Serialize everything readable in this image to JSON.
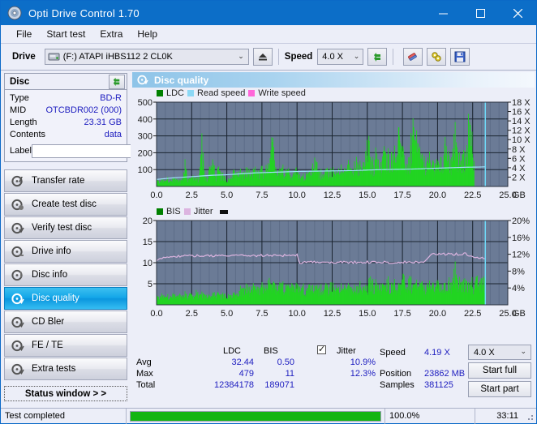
{
  "window": {
    "title": "Opti Drive Control 1.70",
    "title_icon": "disc-icon",
    "minimize": "—",
    "maximize": "□",
    "close": "✕",
    "accent": "#0c6ec8"
  },
  "menu": [
    {
      "label": "File"
    },
    {
      "label": "Start test"
    },
    {
      "label": "Extra"
    },
    {
      "label": "Help"
    }
  ],
  "toolbar": {
    "drive_label": "Drive",
    "drive_value": "(F:)  ATAPI iHBS112  2 CL0K",
    "eject_icon": "eject-icon",
    "speed_label": "Speed",
    "speed_value": "4.0 X",
    "refresh_icon": "refresh-icon",
    "erase_icon": "eraser-icon",
    "tools_icon": "tools-icon",
    "save_icon": "save-icon"
  },
  "disc": {
    "header": "Disc",
    "refresh_icon": "refresh-icon",
    "rows": [
      {
        "key": "Type",
        "value": "BD-R"
      },
      {
        "key": "MID",
        "value": "OTCBDR002 (000)"
      },
      {
        "key": "Length",
        "value": "23.31 GB"
      },
      {
        "key": "Contents",
        "value": "data"
      }
    ],
    "label_key": "Label",
    "label_value": "",
    "label_placeholder": "",
    "label_icon": "cd-icon"
  },
  "tests": [
    {
      "label": "Transfer rate",
      "icon": "disc-speed-icon",
      "active": false
    },
    {
      "label": "Create test disc",
      "icon": "disc-write-icon",
      "active": false
    },
    {
      "label": "Verify test disc",
      "icon": "disc-verify-icon",
      "active": false
    },
    {
      "label": "Drive info",
      "icon": "drive-info-icon",
      "active": false
    },
    {
      "label": "Disc info",
      "icon": "disc-info-icon",
      "active": false
    },
    {
      "label": "Disc quality",
      "icon": "disc-quality-icon",
      "active": true
    },
    {
      "label": "CD Bler",
      "icon": "disc-bler-icon",
      "active": false
    },
    {
      "label": "FE / TE",
      "icon": "disc-fete-icon",
      "active": false
    },
    {
      "label": "Extra tests",
      "icon": "disc-extra-icon",
      "active": false
    }
  ],
  "status_window_button": "Status window > >",
  "panel": {
    "title": "Disc quality",
    "icon": "disc-quality-icon"
  },
  "stats": {
    "col_ldc": "LDC",
    "col_bis": "BIS",
    "jitter_label": "Jitter",
    "jitter_checked": true,
    "row_avg": "Avg",
    "row_max": "Max",
    "row_total": "Total",
    "avg_ldc": "32.44",
    "avg_bis": "0.50",
    "avg_jitter": "10.9%",
    "max_ldc": "479",
    "max_bis": "11",
    "max_jitter": "12.3%",
    "total_ldc": "12384178",
    "total_bis": "189071",
    "speed_label": "Speed",
    "speed_value": "4.19 X",
    "position_label": "Position",
    "position_value": "23862 MB",
    "samples_label": "Samples",
    "samples_value": "381125",
    "speed_select": "4.0 X",
    "start_full": "Start full",
    "start_part": "Start part"
  },
  "statusbar": {
    "message": "Test completed",
    "percent_text": "100.0%",
    "percent_value": 100,
    "elapsed": "33:11"
  },
  "chart_data": [
    {
      "type": "area",
      "id": "quality-chart",
      "title": "",
      "xlabel": "GB",
      "ylabel": "",
      "xlim": [
        0,
        25
      ],
      "xticks": [
        "0.0",
        "2.5",
        "5.0",
        "7.5",
        "10.0",
        "12.5",
        "15.0",
        "17.5",
        "20.0",
        "22.5",
        "25.0"
      ],
      "ylim": [
        0,
        500
      ],
      "yticks": [
        "100",
        "200",
        "300",
        "400",
        "500"
      ],
      "y2lim": [
        0,
        18
      ],
      "y2ticks": [
        "2 X",
        "4 X",
        "6 X",
        "8 X",
        "10 X",
        "12 X",
        "14 X",
        "16 X",
        "18 X"
      ],
      "grid": true,
      "plot_bg": "#6b7b96",
      "legend_position": "top-left",
      "legend": [
        {
          "name": "LDC",
          "color": "#008000"
        },
        {
          "name": "Read speed",
          "color": "#8cd8f5"
        },
        {
          "name": "Write speed",
          "color": "#ff66d9"
        }
      ],
      "series": [
        {
          "name": "LDC",
          "type": "bar",
          "color": "#22d422",
          "x": [
            0.0,
            0.2,
            0.4,
            0.6,
            0.8,
            1.0,
            1.2,
            1.4,
            1.6,
            1.8,
            2.0,
            2.2,
            2.4,
            2.6,
            2.8,
            3.0,
            3.2,
            3.4,
            3.6,
            3.8,
            4.0,
            4.2,
            4.4,
            4.6,
            4.8,
            5.0,
            5.2,
            5.4,
            5.6,
            5.8,
            6.0,
            6.2,
            6.4,
            6.6,
            6.8,
            7.0,
            7.2,
            7.4,
            7.6,
            7.8,
            8.0,
            8.2,
            8.4,
            8.6,
            8.8,
            9.0,
            9.2,
            9.4,
            9.6,
            9.8,
            10.0,
            10.2,
            10.4,
            10.6,
            10.8,
            11.0,
            11.2,
            11.4,
            11.6,
            11.8,
            12.0,
            12.2,
            12.4,
            12.6,
            12.8,
            13.0,
            13.2,
            13.4,
            13.6,
            13.8,
            14.0,
            14.2,
            14.4,
            14.6,
            14.8,
            15.0,
            15.2,
            15.4,
            15.6,
            15.8,
            16.0,
            16.2,
            16.4,
            16.6,
            16.8,
            17.0,
            17.2,
            17.4,
            17.6,
            17.8,
            18.0,
            18.2,
            18.4,
            18.6,
            18.8,
            19.0,
            19.2,
            19.4,
            19.6,
            19.8,
            20.0,
            20.2,
            20.4,
            20.6,
            20.8,
            21.0,
            21.2,
            21.4,
            21.6,
            21.8,
            22.0,
            22.2,
            22.4,
            22.6,
            22.8,
            23.0,
            23.2,
            23.4
          ],
          "values": [
            40,
            35,
            45,
            38,
            60,
            42,
            55,
            48,
            40,
            52,
            150,
            60,
            45,
            90,
            50,
            45,
            290,
            70,
            55,
            170,
            160,
            60,
            120,
            80,
            70,
            50,
            55,
            85,
            100,
            85,
            95,
            90,
            110,
            105,
            95,
            120,
            100,
            115,
            95,
            140,
            110,
            330,
            130,
            95,
            120,
            115,
            105,
            100,
            95,
            130,
            95,
            75,
            70,
            110,
            85,
            90,
            200,
            130,
            95,
            105,
            95,
            115,
            90,
            105,
            100,
            120,
            115,
            105,
            160,
            110,
            135,
            180,
            130,
            150,
            170,
            330,
            180,
            150,
            220,
            160,
            150,
            270,
            190,
            250,
            200,
            230,
            390,
            220,
            200,
            180,
            175,
            450,
            300,
            320,
            200,
            190,
            170,
            180,
            165,
            175,
            170,
            180,
            175,
            390,
            200,
            185,
            380,
            210,
            200,
            195,
            210,
            480,
            300,
            250
          ]
        },
        {
          "name": "Read speed",
          "type": "line",
          "color": "#9fe0fa",
          "x": [
            0.0,
            1.0,
            2.0,
            3.0,
            4.0,
            5.0,
            6.0,
            7.0,
            8.0,
            9.0,
            10.0,
            11.0,
            12.0,
            13.0,
            14.0,
            15.0,
            16.0,
            17.0,
            18.0,
            19.0,
            20.0,
            21.0,
            22.0,
            23.0,
            23.4
          ],
          "values": [
            1.5,
            1.8,
            2.0,
            2.2,
            2.4,
            2.5,
            2.7,
            2.9,
            3.0,
            3.1,
            3.2,
            3.25,
            3.3,
            3.35,
            3.4,
            3.5,
            3.6,
            3.65,
            3.7,
            3.8,
            3.9,
            4.0,
            4.1,
            4.15,
            4.2
          ]
        }
      ]
    },
    {
      "type": "area",
      "id": "jitter-chart",
      "title": "",
      "xlabel": "GB",
      "ylabel": "",
      "xlim": [
        0,
        25
      ],
      "xticks": [
        "0.0",
        "2.5",
        "5.0",
        "7.5",
        "10.0",
        "12.5",
        "15.0",
        "17.5",
        "20.0",
        "22.5",
        "25.0"
      ],
      "ylim": [
        0,
        20
      ],
      "yticks": [
        "5",
        "10",
        "15",
        "20"
      ],
      "y2lim": [
        0,
        20
      ],
      "y2ticks": [
        "4%",
        "8%",
        "12%",
        "16%",
        "20%"
      ],
      "grid": true,
      "plot_bg": "#6b7b96",
      "legend_position": "top-left",
      "legend": [
        {
          "name": "BIS",
          "color": "#008000"
        },
        {
          "name": "Jitter",
          "color": "#dcb4e0"
        }
      ],
      "series": [
        {
          "name": "BIS",
          "type": "bar",
          "color": "#22d422",
          "x": [
            0.0,
            0.2,
            0.4,
            0.6,
            0.8,
            1.0,
            1.2,
            1.4,
            1.6,
            1.8,
            2.0,
            2.2,
            2.4,
            2.6,
            2.8,
            3.0,
            3.2,
            3.4,
            3.6,
            3.8,
            4.0,
            4.2,
            4.4,
            4.6,
            4.8,
            5.0,
            5.2,
            5.4,
            5.6,
            5.8,
            6.0,
            6.2,
            6.4,
            6.6,
            6.8,
            7.0,
            7.2,
            7.4,
            7.6,
            7.8,
            8.0,
            8.2,
            8.4,
            8.6,
            8.8,
            9.0,
            9.2,
            9.4,
            9.6,
            9.8,
            10.0,
            10.2,
            10.4,
            10.6,
            10.8,
            11.0,
            11.2,
            11.4,
            11.6,
            11.8,
            12.0,
            12.2,
            12.4,
            12.6,
            12.8,
            13.0,
            13.2,
            13.4,
            13.6,
            13.8,
            14.0,
            14.2,
            14.4,
            14.6,
            14.8,
            15.0,
            15.2,
            15.4,
            15.6,
            15.8,
            16.0,
            16.2,
            16.4,
            16.6,
            16.8,
            17.0,
            17.2,
            17.4,
            17.6,
            17.8,
            18.0,
            18.2,
            18.4,
            18.6,
            18.8,
            19.0,
            19.2,
            19.4,
            19.6,
            19.8,
            20.0,
            20.2,
            20.4,
            20.6,
            20.8,
            21.0,
            21.2,
            21.4,
            21.6,
            21.8,
            22.0,
            22.2,
            22.4,
            22.6,
            22.8,
            23.0,
            23.2,
            23.4
          ],
          "values": [
            2.0,
            2.2,
            2.5,
            2.1,
            2.6,
            2.3,
            2.8,
            2.2,
            2.7,
            2.4,
            3.0,
            2.5,
            2.8,
            2.6,
            3.1,
            2.4,
            2.9,
            2.6,
            2.7,
            2.5,
            3.0,
            2.6,
            2.8,
            2.5,
            2.9,
            2.6,
            2.8,
            2.5,
            3.0,
            2.7,
            4.5,
            4.2,
            4.8,
            4.4,
            5.0,
            4.6,
            4.8,
            4.3,
            5.2,
            4.7,
            5.6,
            4.9,
            5.3,
            4.6,
            6.0,
            4.8,
            5.1,
            4.5,
            8.0,
            4.9,
            5.2,
            4.6,
            5.0,
            4.4,
            4.9,
            4.5,
            5.1,
            4.3,
            4.8,
            4.6,
            5.0,
            4.4,
            4.9,
            4.5,
            5.0,
            4.3,
            4.8,
            4.6,
            5.1,
            4.4,
            4.9,
            4.5,
            5.2,
            4.6,
            5.0,
            4.4,
            6.9,
            5.2,
            5.6,
            5.0,
            5.4,
            4.8,
            6.6,
            5.2,
            6.0,
            5.1,
            5.5,
            5.0,
            7.5,
            5.3,
            7.2,
            5.0,
            5.8,
            5.2,
            6.1,
            4.9,
            5.4,
            5.0,
            5.8,
            5.2,
            6.5,
            5.0,
            5.6,
            5.1,
            7.0,
            5.4,
            10.2,
            5.8,
            7.0,
            5.3,
            6.8,
            5.2,
            6.0,
            5.5,
            7.1,
            5.4,
            7.8,
            6.0
          ]
        },
        {
          "name": "Jitter",
          "type": "line",
          "color": "#dcb4e0",
          "x": [
            0.0,
            0.5,
            1.0,
            2.0,
            3.0,
            4.0,
            5.0,
            6.0,
            7.0,
            8.0,
            9.0,
            10.0,
            10.2,
            11.0,
            12.0,
            13.0,
            14.0,
            15.0,
            16.0,
            17.0,
            18.0,
            19.0,
            19.6,
            20.0,
            21.0,
            22.0,
            22.6,
            23.4
          ],
          "values": [
            10.3,
            11.3,
            11.5,
            11.6,
            11.6,
            11.6,
            11.7,
            11.7,
            11.7,
            11.7,
            11.7,
            11.8,
            10.0,
            10.1,
            10.1,
            10.1,
            10.1,
            10.1,
            10.1,
            10.1,
            10.1,
            10.2,
            11.9,
            12.0,
            12.0,
            12.1,
            11.1,
            11.0
          ]
        }
      ]
    }
  ]
}
